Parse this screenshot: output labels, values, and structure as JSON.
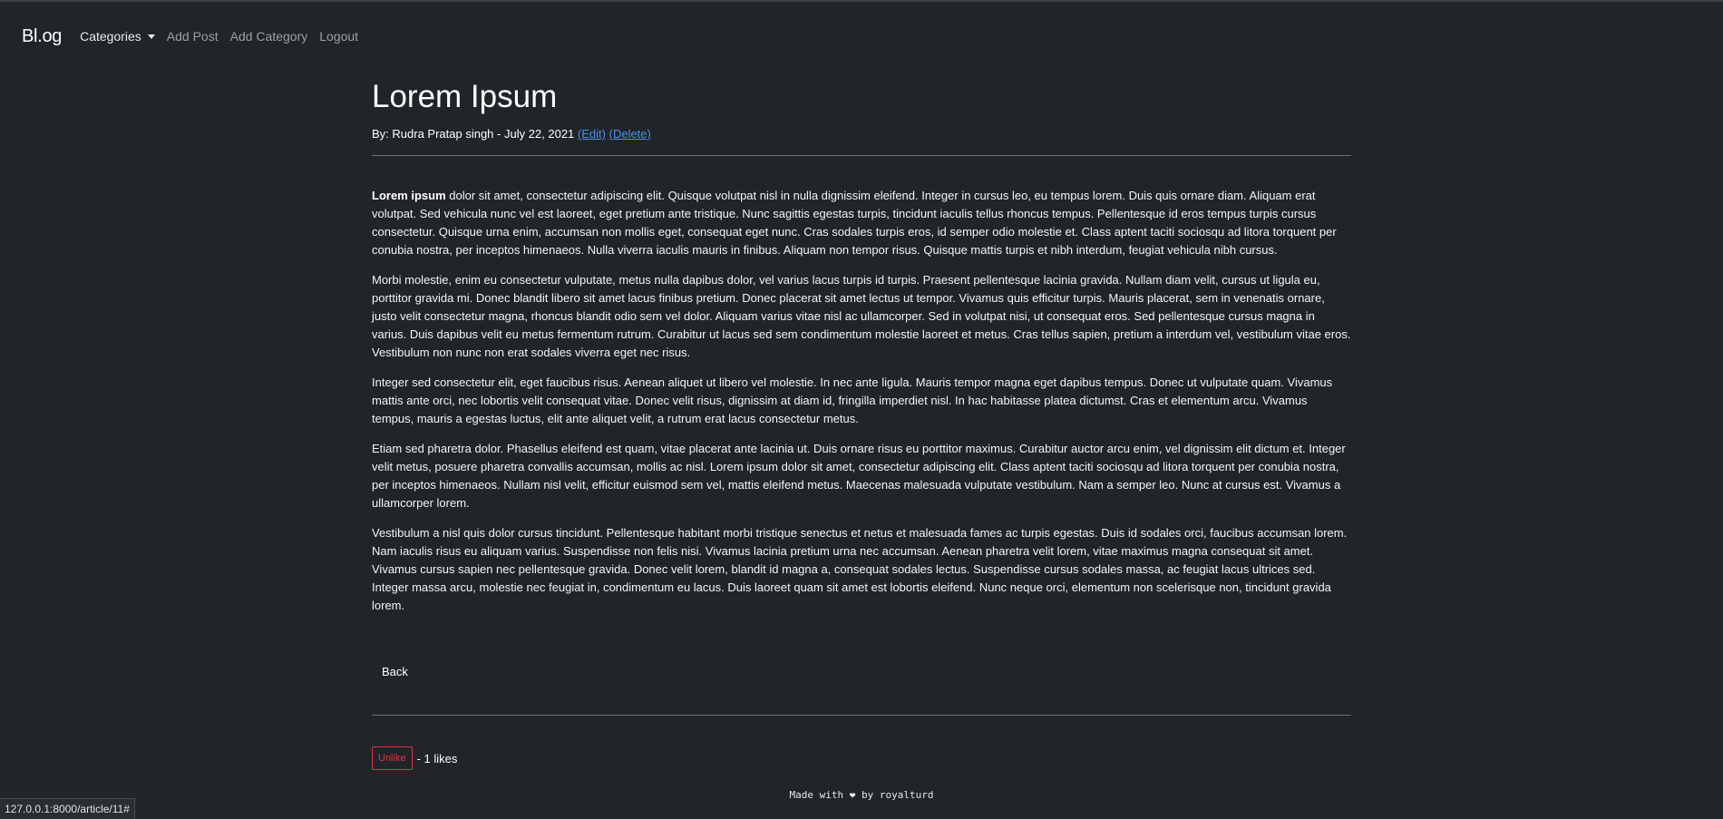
{
  "nav": {
    "brand": "Bl.og",
    "categories_label": "Categories",
    "add_post": "Add Post",
    "add_category": "Add Category",
    "logout": "Logout"
  },
  "article": {
    "title": "Lorem Ipsum",
    "byline": "By: Rudra Pratap singh - July 22, 2021",
    "edit_link": "(Edit)",
    "delete_link": "(Delete)",
    "lead_bold": "Lorem ipsum",
    "paragraphs": [
      " dolor sit amet, consectetur adipiscing elit. Quisque volutpat nisl in nulla dignissim eleifend. Integer in cursus leo, eu tempus lorem. Duis quis ornare diam. Aliquam erat volutpat. Sed vehicula nunc vel est laoreet, eget pretium ante tristique. Nunc sagittis egestas turpis, tincidunt iaculis tellus rhoncus tempus. Pellentesque id eros tempus turpis cursus consectetur. Quisque urna enim, accumsan non mollis eget, consequat eget nunc. Cras sodales turpis eros, id semper odio molestie et. Class aptent taciti sociosqu ad litora torquent per conubia nostra, per inceptos himenaeos. Nulla viverra iaculis mauris in finibus. Aliquam non tempor risus. Quisque mattis turpis et nibh interdum, feugiat vehicula nibh cursus.",
      "Morbi molestie, enim eu consectetur vulputate, metus nulla dapibus dolor, vel varius lacus turpis id turpis. Praesent pellentesque lacinia gravida. Nullam diam velit, cursus ut ligula eu, porttitor gravida mi. Donec blandit libero sit amet lacus finibus pretium. Donec placerat sit amet lectus ut tempor. Vivamus quis efficitur turpis. Mauris placerat, sem in venenatis ornare, justo velit consectetur magna, rhoncus blandit odio sem vel dolor. Aliquam varius vitae nisl ac ullamcorper. Sed in volutpat nisi, ut consequat eros. Sed pellentesque cursus magna in varius. Duis dapibus velit eu metus fermentum rutrum. Curabitur ut lacus sed sem condimentum molestie laoreet et metus. Cras tellus sapien, pretium a interdum vel, vestibulum vitae eros. Vestibulum non nunc non erat sodales viverra eget nec risus.",
      "Integer sed consectetur elit, eget faucibus risus. Aenean aliquet ut libero vel molestie. In nec ante ligula. Mauris tempor magna eget dapibus tempus. Donec ut vulputate quam. Vivamus mattis ante orci, nec lobortis velit consequat vitae. Donec velit risus, dignissim at diam id, fringilla imperdiet nisl. In hac habitasse platea dictumst. Cras et elementum arcu. Vivamus tempus, mauris a egestas luctus, elit ante aliquet velit, a rutrum erat lacus consectetur metus.",
      "Etiam sed pharetra dolor. Phasellus eleifend est quam, vitae placerat ante lacinia ut. Duis ornare risus eu porttitor maximus. Curabitur auctor arcu enim, vel dignissim elit dictum et. Integer velit metus, posuere pharetra convallis accumsan, mollis ac nisl. Lorem ipsum dolor sit amet, consectetur adipiscing elit. Class aptent taciti sociosqu ad litora torquent per conubia nostra, per inceptos himenaeos. Nullam nisl velit, efficitur euismod sem vel, mattis eleifend metus. Maecenas malesuada vulputate vestibulum. Nam a semper leo. Nunc at cursus est. Vivamus a ullamcorper lorem.",
      "Vestibulum a nisl quis dolor cursus tincidunt. Pellentesque habitant morbi tristique senectus et netus et malesuada fames ac turpis egestas. Duis id sodales orci, faucibus accumsan lorem. Nam iaculis risus eu aliquam varius. Suspendisse non felis nisi. Vivamus lacinia pretium urna nec accumsan. Aenean pharetra velit lorem, vitae maximus magna consequat sit amet. Vivamus cursus sapien nec pellentesque gravida. Donec velit lorem, blandit id magna a, consequat sodales lectus. Suspendisse cursus sodales massa, ac feugiat lacus ultrices sed. Integer massa arcu, molestie nec feugiat in, condimentum eu lacus. Duis laoreet quam sit amet est lobortis eleifend. Nunc neque orci, elementum non scelerisque non, tincidunt gravida lorem."
    ]
  },
  "actions": {
    "back": "Back",
    "unlike": "Unlike",
    "likes_text": "- 1 likes"
  },
  "footer": {
    "made_with": "Made with",
    "heart_icon": "heart-icon",
    "by": "by royalturd"
  },
  "status_bar": {
    "url": "127.0.0.1:8000/article/11#"
  },
  "colors": {
    "background": "#212428",
    "link": "#4b8fe8",
    "danger": "#dc3545"
  }
}
